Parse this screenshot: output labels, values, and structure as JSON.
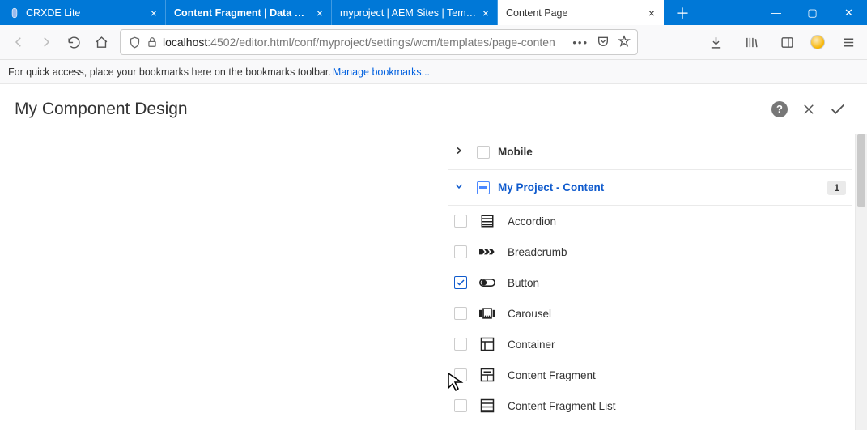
{
  "browser": {
    "tabs": [
      {
        "label": "CRXDE Lite"
      },
      {
        "label": "Content Fragment | Data Mod…"
      },
      {
        "label": "myproject | AEM Sites | Templat…"
      },
      {
        "label": "Content Page"
      }
    ],
    "active_tab": 3,
    "url_prefix": "localhost",
    "url_rest": ":4502/editor.html/conf/myproject/settings/wcm/templates/page-conten",
    "bookmarks_hint": "For quick access, place your bookmarks here on the bookmarks toolbar.",
    "bookmarks_link": "Manage bookmarks..."
  },
  "dialog": {
    "title": "My Component Design"
  },
  "groups": [
    {
      "name": "Mobile",
      "expanded": false
    },
    {
      "name": "My Project - Content",
      "expanded": true,
      "badge": "1"
    }
  ],
  "components": [
    {
      "name": "Accordion",
      "checked": false,
      "icon": "accordion"
    },
    {
      "name": "Breadcrumb",
      "checked": false,
      "icon": "breadcrumb"
    },
    {
      "name": "Button",
      "checked": true,
      "icon": "button"
    },
    {
      "name": "Carousel",
      "checked": false,
      "icon": "carousel"
    },
    {
      "name": "Container",
      "checked": false,
      "icon": "container"
    },
    {
      "name": "Content Fragment",
      "checked": false,
      "icon": "fragment"
    },
    {
      "name": "Content Fragment List",
      "checked": false,
      "icon": "fragmentlist"
    }
  ]
}
